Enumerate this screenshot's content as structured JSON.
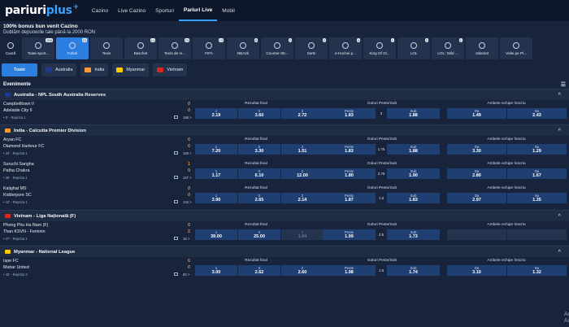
{
  "header": {
    "logo_main": "pariuri",
    "logo_plus": "plus",
    "nav": [
      "Cazino",
      "Live Cazino",
      "Sporturi",
      "Pariuri Live",
      "Mobil"
    ],
    "active_nav": "Pariuri Live"
  },
  "promo": {
    "title": "100% bonus bun venit Cazino",
    "subtitle": "Dublăm depunerile tale până la 2000 RON"
  },
  "sports": [
    {
      "label": "Caută",
      "count": ""
    },
    {
      "label": "Toate sport...",
      "count": "206"
    },
    {
      "label": "Fotbal",
      "count": "22"
    },
    {
      "label": "Tenis",
      "count": ""
    },
    {
      "label": "Baschet",
      "count": "14"
    },
    {
      "label": "Tenis de m...",
      "count": "23"
    },
    {
      "label": "FIFA",
      "count": "13"
    },
    {
      "label": "NBA2k",
      "count": "9"
    },
    {
      "label": "Counter-Str...",
      "count": "2"
    },
    {
      "label": "Darts",
      "count": "2"
    },
    {
      "label": "e-Hochei p...",
      "count": "4"
    },
    {
      "label": "King Of Gl...",
      "count": "1"
    },
    {
      "label": "LOL",
      "count": "2"
    },
    {
      "label": "LOL: Wild ...",
      "count": "1"
    },
    {
      "label": "Valorant",
      "count": ""
    },
    {
      "label": "Volei pe Pl...",
      "count": ""
    }
  ],
  "countries": [
    {
      "label": "Toate",
      "flag": ""
    },
    {
      "label": "Australia",
      "flag": "#1f3a8a"
    },
    {
      "label": "India",
      "flag": "#ff9933"
    },
    {
      "label": "Myanmar",
      "flag": "#fecb00"
    },
    {
      "label": "Vietnam",
      "flag": "#da251d"
    }
  ],
  "events_title": "Evenimente",
  "markets": {
    "m1": "Rezultat final",
    "m2": "Goluri Peste/Sub",
    "m3": "Ambele echipe înscriu",
    "k1": "1",
    "kx": "X",
    "k2": "2",
    "over": "Peste",
    "under": "Sub",
    "yes": "Da",
    "no": "Nu"
  },
  "leagues": [
    {
      "name": "Australia - NPL South Australia Reserves",
      "flag": "#1f3a8a",
      "matches": [
        {
          "home": "Campbelltown II",
          "away": "Adelaide City II",
          "hs": "0",
          "as": "0",
          "period": "• 5' - Repriza 1",
          "more": "186 >",
          "o1": "2.19",
          "ox": "3.60",
          "o2": "2.72",
          "over": "1.83",
          "line": "3",
          "under": "1.88",
          "yes": "1.49",
          "no": "2.43"
        }
      ]
    },
    {
      "name": "India - Calcutta Premier Division",
      "flag": "#ff9933",
      "matches": [
        {
          "home": "Aryan FC",
          "away": "Diamond Harbour FC",
          "hs": "0",
          "as": "0",
          "period": "• 34' - Repriza 1",
          "more": "159 >",
          "o1": "7.20",
          "ox": "3.30",
          "o2": "1.51",
          "over": "1.83",
          "line": "1.75",
          "under": "1.88",
          "yes": "3.30",
          "no": "1.29"
        },
        {
          "home": "Suruchi Sangha",
          "away": "Patha Chakra",
          "hs": "1",
          "as": "0",
          "period": "• 36' - Repriza 1",
          "more": "147 >",
          "o1": "1.17",
          "ox": "6.10",
          "o2": "12.00",
          "over": "1.80",
          "line": "2.75",
          "under": "1.90",
          "yes": "2.80",
          "no": "1.67"
        },
        {
          "home": "Kalighat MS",
          "away": "Kidderpore SC",
          "hs": "0",
          "as": "0",
          "period": "• 42' - Repriza 1",
          "more": "134 >",
          "o1": "3.90",
          "ox": "2.65",
          "o2": "2.14",
          "over": "1.87",
          "line": "1.5",
          "under": "1.83",
          "yes": "2.97",
          "no": "1.35"
        }
      ]
    },
    {
      "name": "Vietnam - Liga Națională (F)",
      "flag": "#da251d",
      "matches": [
        {
          "home": "Phong Phu Ha Nam (F)",
          "away": "Than KSVN - Feminin",
          "hs": "0",
          "as": "2",
          "period": "• 47' - Repriza 1",
          "more": "16 >",
          "o1": "39.00",
          "ox": "25.00",
          "o2": "1.04",
          "over": "1.99",
          "line": "2.5",
          "under": "1.73",
          "yes": "",
          "no": "",
          "dim2": true
        }
      ]
    },
    {
      "name": "Myanmar - National League",
      "flag": "#fecb00",
      "matches": [
        {
          "home": "Ispe FC",
          "away": "Mahar United",
          "hs": "0",
          "as": "0",
          "period": "• 43' - Repriza 2",
          "more": "60 >",
          "o1": "3.00",
          "ox": "2.62",
          "o2": "2.60",
          "over": "1.98",
          "line": "1.5",
          "under": "1.74",
          "yes": "3.10",
          "no": "1.32"
        }
      ]
    }
  ],
  "watermark": [
    "Ac",
    "Ac"
  ]
}
